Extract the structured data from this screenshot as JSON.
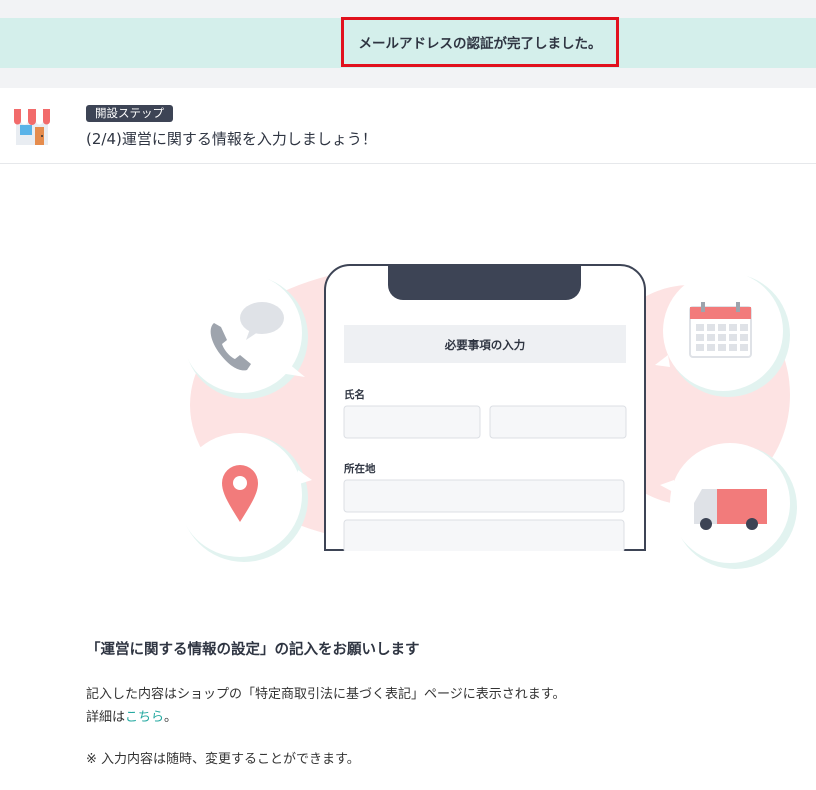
{
  "notice": {
    "message": "メールアドレスの認証が完了しました。"
  },
  "step": {
    "badge": "開設ステップ",
    "title": "(2/4)運営に関する情報を入力しましょう！"
  },
  "illustration": {
    "form_header": "必要事項の入力",
    "name_label": "氏名",
    "address_label": "所在地"
  },
  "content": {
    "heading": "「運営に関する情報の設定」の記入をお願いします",
    "description": "記入した内容はショップの「特定商取引法に基づく表記」ページに表示されます。",
    "details_prefix": "詳細は",
    "details_link": "こちら",
    "details_suffix": "。",
    "note": "※ 入力内容は随時、変更することができます。"
  },
  "colors": {
    "notice_bg": "#d4efeb",
    "highlight_border": "#e1111d",
    "badge_bg": "#3d4455",
    "link": "#25a9a1",
    "accent_red": "#f27b7b"
  },
  "icons": [
    "shop-icon",
    "phone-icon",
    "speech-bubble-icon",
    "calendar-icon",
    "location-pin-icon",
    "truck-icon"
  ]
}
